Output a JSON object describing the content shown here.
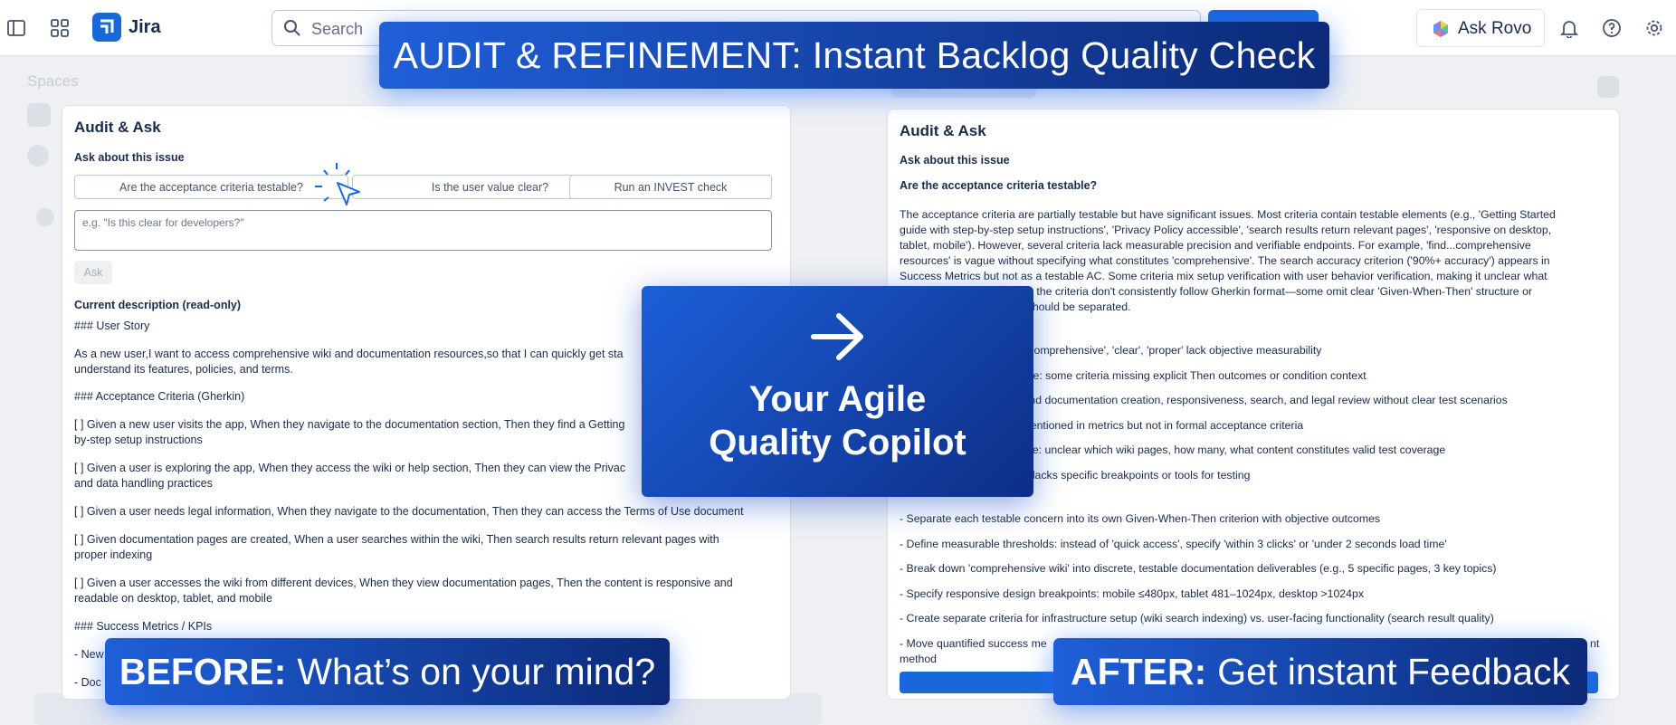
{
  "topnav": {
    "app_name": "Jira",
    "search_placeholder": "Search",
    "ask_rovo_label": "Ask Rovo"
  },
  "background": {
    "spaces_label": "Spaces"
  },
  "banners": {
    "top_title": "AUDIT & REFINEMENT: Instant Backlog Quality Check",
    "center_line1": "Your Agile",
    "center_line2": "Quality Copilot",
    "before_bold": "BEFORE:",
    "before_text": "What’s on your mind?",
    "after_bold": "AFTER:",
    "after_text": "Get instant Feedback"
  },
  "left_panel": {
    "title": "Audit & Ask",
    "ask_heading": "Ask about this issue",
    "chips": [
      "Are the acceptance criteria testable?",
      "Is the user value clear?",
      "Run an INVEST check"
    ],
    "input_placeholder": "e.g. \"Is this clear for developers?\"",
    "ask_button": "Ask",
    "desc_heading": "Current description (read-only)",
    "desc_lines": [
      "### User Story",
      "As a new user,I want to access comprehensive wiki and documentation resources,so that I can quickly get sta",
      "understand its features, policies, and terms.",
      "### Acceptance Criteria (Gherkin)",
      "[ ] Given a new user visits the app, When they navigate to the documentation section, Then they find a Getting",
      "by-step setup instructions",
      "[ ] Given a user is exploring the app, When they access the wiki or help section, Then they can view the Privac",
      "and data handling practices",
      "[ ] Given a user needs legal information, When they navigate to the documentation, Then they can access the Terms of Use document",
      "[ ] Given documentation pages are created, When a user searches within the wiki, Then search results return relevant pages with",
      "proper indexing",
      "[ ] Given a user accesses the wiki from different devices, When they view documentation pages, Then the content is responsive and",
      "readable on desktop, tablet, and mobile",
      "### Success Metrics / KPIs",
      "- New",
      "- Doc"
    ]
  },
  "right_panel": {
    "title": "Audit & Ask",
    "ask_heading": "Ask about this issue",
    "question": "Are the acceptance criteria testable?",
    "answer_lines": [
      "The acceptance criteria are partially testable but have significant issues. Most criteria contain testable elements (e.g., 'Getting Started",
      "guide with step-by-step setup instructions', 'Privacy Policy accessible', 'search results return relevant pages', 'responsive on desktop,",
      "tablet, mobile'). However, several criteria lack measurable precision and verifiable endpoints. For example, 'find...comprehensive",
      "resources' is vague without specifying what constitutes 'comprehensive'. The search accuracy criterion ('90%+ accuracy') appears in",
      "Success Metrics but not as a testable AC. Some criteria mix setup verification with user behavior verification, making it unclear what",
      "ally, the criteria don't consistently follow Gherkin format—some omit clear 'Given-When-Then' structure or",
      "at should be separated.",
      "s: 'comprehensive', 'clear', 'proper' lack objective measurability",
      "cture: some criteria missing explicit Then outcomes or condition context",
      "blend documentation creation, responsiveness, search, and legal review without clear test scenarios",
      ") mentioned in metrics but not in formal acceptance criteria",
      "cope: unclear which wiki pages, how many, what content constitutes valid test coverage",
      "ion lacks specific breakpoints or tools for testing",
      "- Separate each testable concern into its own Given-When-Then criterion with objective outcomes",
      "- Define measurable thresholds: instead of 'quick access', specify 'within 3 clicks' or 'under 2 seconds load time'",
      "- Break down 'comprehensive wiki' into discrete, testable documentation deliverables (e.g., 5 specific pages, 3 key topics)",
      "- Specify responsive design breakpoints: mobile ≤480px, tablet 481–1024px, desktop >1024px",
      "- Create separate criteria for infrastructure setup (wiki search indexing) vs. user-facing functionality (search result quality)",
      "- Move quantified success me",
      "method",
      "nt"
    ]
  },
  "colors": {
    "accent": "#1868db",
    "banner_dark": "#0c2a78",
    "text": "#172b4d"
  },
  "icons": [
    "sidebar-toggle-icon",
    "app-switcher-icon",
    "jira-logo-icon",
    "search-icon",
    "rovo-logo-icon",
    "bell-icon",
    "help-icon",
    "gear-icon",
    "arrow-right-icon",
    "click-cursor-icon"
  ]
}
